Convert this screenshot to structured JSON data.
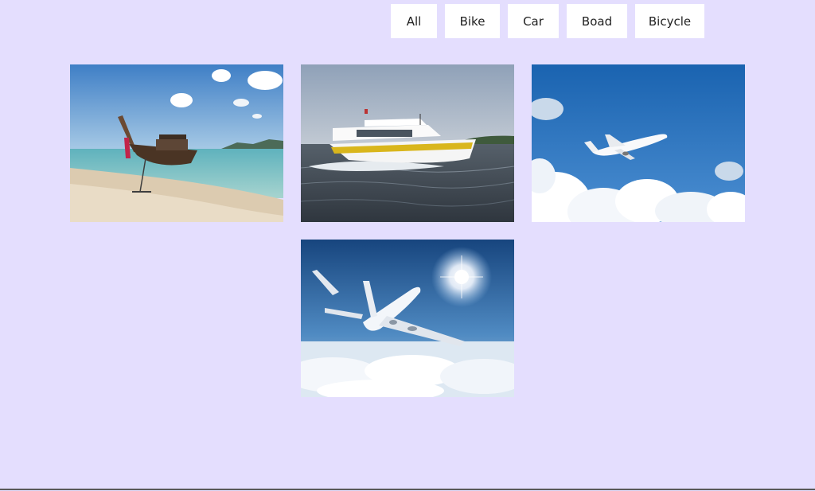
{
  "filters": {
    "buttons": [
      "All",
      "Bike",
      "Car",
      "Boad",
      "Bicycle"
    ]
  },
  "gallery": {
    "items": [
      {
        "subject": "longtail-boat-on-beach"
      },
      {
        "subject": "motor-boat-on-water"
      },
      {
        "subject": "airplane-in-blue-sky"
      },
      {
        "subject": "airplane-above-clouds-with-sun"
      }
    ]
  },
  "colors": {
    "background": "#e4defe",
    "button_bg": "#ffffff",
    "button_text": "#222222"
  }
}
